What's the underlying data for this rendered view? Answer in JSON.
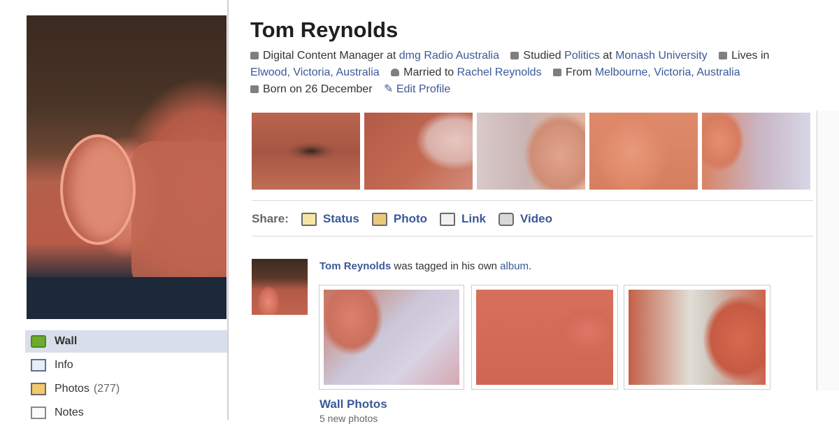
{
  "profile": {
    "name": "Tom Reynolds",
    "about": {
      "job_prefix": "Digital Content Manager at",
      "job_company": "dmg Radio Australia",
      "studied_prefix": "Studied",
      "studied_subject": "Politics",
      "studied_at": "at",
      "studied_school": "Monash University",
      "lives_prefix": "Lives in",
      "lives_place": "Elwood, Victoria, Australia",
      "married_prefix": "Married to",
      "married_name": "Rachel Reynolds",
      "from_prefix": "From",
      "from_place": "Melbourne, Victoria, Australia",
      "born": "Born on 26 December",
      "edit_profile": "Edit Profile"
    }
  },
  "sidebar": {
    "items": [
      {
        "label": "Wall",
        "icon": "wall-icon"
      },
      {
        "label": "Info",
        "icon": "info-icon"
      },
      {
        "label": "Photos",
        "count": "(277)",
        "icon": "photos-icon"
      },
      {
        "label": "Notes",
        "icon": "notes-icon"
      }
    ]
  },
  "share": {
    "label": "Share:",
    "items": [
      {
        "label": "Status",
        "icon": "status-icon"
      },
      {
        "label": "Photo",
        "icon": "photo-icon"
      },
      {
        "label": "Link",
        "icon": "link-icon"
      },
      {
        "label": "Video",
        "icon": "video-icon"
      }
    ]
  },
  "feed": {
    "author": "Tom Reynolds",
    "text_mid": "was tagged in his own",
    "album_link": "album",
    "text_end": ".",
    "album_title": "Wall Photos",
    "album_sub": "5 new photos"
  },
  "colors": {
    "link": "#3b5998",
    "nav_selected": "#d8dfea"
  }
}
